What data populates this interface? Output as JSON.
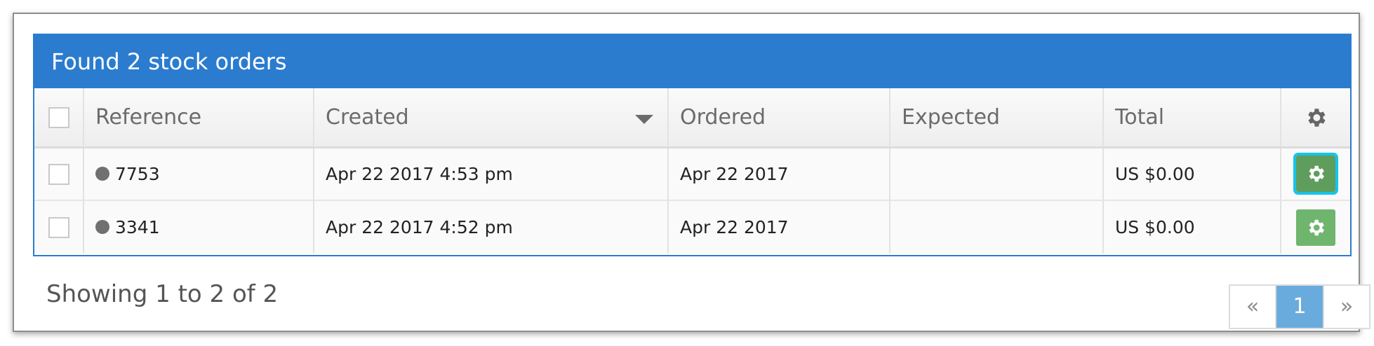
{
  "header": {
    "title": "Found 2 stock orders"
  },
  "table": {
    "columns": {
      "reference": "Reference",
      "created": "Created",
      "ordered": "Ordered",
      "expected": "Expected",
      "total": "Total"
    },
    "sorted_column": "created",
    "sort_direction": "descending",
    "rows": [
      {
        "reference": "7753",
        "created": "Apr 22 2017 4:53 pm",
        "ordered": "Apr 22 2017",
        "expected": "",
        "total": "US $0.00"
      },
      {
        "reference": "3341",
        "created": "Apr 22 2017 4:52 pm",
        "ordered": "Apr 22 2017",
        "expected": "",
        "total": "US $0.00"
      }
    ]
  },
  "footer": {
    "summary": "Showing 1 to 2 of 2"
  },
  "pagination": {
    "prev": "«",
    "current": "1",
    "next": "»"
  },
  "colors": {
    "header_bg": "#2b7ccf",
    "action_button": "#6fb56e",
    "focus_outline": "#15c4ea",
    "page_active": "#6aabdd"
  },
  "icons": {
    "header_settings": "gear-icon",
    "row_action": "gear-icon",
    "status": "status-dot"
  }
}
